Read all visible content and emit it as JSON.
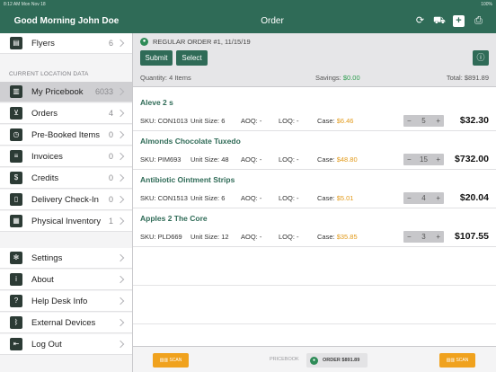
{
  "status_bar": {
    "time": "8:12 AM   Mon Nov 18",
    "battery": "100%"
  },
  "sidebar": {
    "greeting": "Good Morning John Doe",
    "top_items": [
      {
        "label": "Flyers",
        "count": "6",
        "icon": "flyers-icon"
      }
    ],
    "section_label": "CURRENT LOCATION DATA",
    "items": [
      {
        "label": "My Pricebook",
        "count": "6033",
        "icon": "pricebook-icon",
        "selected": true
      },
      {
        "label": "Orders",
        "count": "4",
        "icon": "cart-icon"
      },
      {
        "label": "Pre-Booked Items",
        "count": "0",
        "icon": "clock-icon"
      },
      {
        "label": "Invoices",
        "count": "0",
        "icon": "invoice-icon"
      },
      {
        "label": "Credits",
        "count": "0",
        "icon": "dollar-icon"
      },
      {
        "label": "Delivery Check-In",
        "count": "0",
        "icon": "clipboard-icon"
      },
      {
        "label": "Physical Inventory",
        "count": "1",
        "icon": "inventory-icon"
      }
    ],
    "bottom_items": [
      {
        "label": "Settings",
        "icon": "gear-icon"
      },
      {
        "label": "About",
        "icon": "info-icon"
      },
      {
        "label": "Help Desk Info",
        "icon": "help-icon"
      },
      {
        "label": "External Devices",
        "icon": "bluetooth-icon"
      },
      {
        "label": "Log Out",
        "icon": "logout-icon"
      }
    ]
  },
  "header": {
    "title": "Order"
  },
  "order": {
    "label": "REGULAR ORDER #1, 11/15/19",
    "submit_label": "Submit",
    "select_label": "Select",
    "quantity_text": "Quantity: 4 Items",
    "savings_label": "Savings:",
    "savings_value": "$0.00",
    "total_text": "Total: $891.89"
  },
  "items": [
    {
      "name": "Aleve 2 s",
      "sku": "CON1013",
      "unit_size": "6",
      "aoq": "-",
      "loq": "-",
      "case": "$6.46",
      "qty": "5",
      "total": "$32.30"
    },
    {
      "name": "Almonds Chocolate Tuxedo",
      "sku": "PIM693",
      "unit_size": "48",
      "aoq": "-",
      "loq": "-",
      "case": "$48.80",
      "qty": "15",
      "total": "$732.00"
    },
    {
      "name": "Antibiotic Ointment  Strips",
      "sku": "CON1513",
      "unit_size": "6",
      "aoq": "-",
      "loq": "-",
      "case": "$5.01",
      "qty": "4",
      "total": "$20.04"
    },
    {
      "name": "Apples 2 The Core",
      "sku": "PLD669",
      "unit_size": "12",
      "aoq": "-",
      "loq": "-",
      "case": "$35.85",
      "qty": "3",
      "total": "$107.55"
    }
  ],
  "field_labels": {
    "sku": "SKU:",
    "unit_size": "Unit Size:",
    "aoq": "AOQ:",
    "loq": "LOQ:",
    "case": "Case:"
  },
  "bottom": {
    "scan_label": "SCAN",
    "pricebook_label": "PRICEBOOK",
    "order_label": "ORDER $891.89"
  },
  "colors": {
    "brand": "#2f6b57",
    "accent_orange": "#f0a21e",
    "savings_green": "#2e9e4f"
  }
}
